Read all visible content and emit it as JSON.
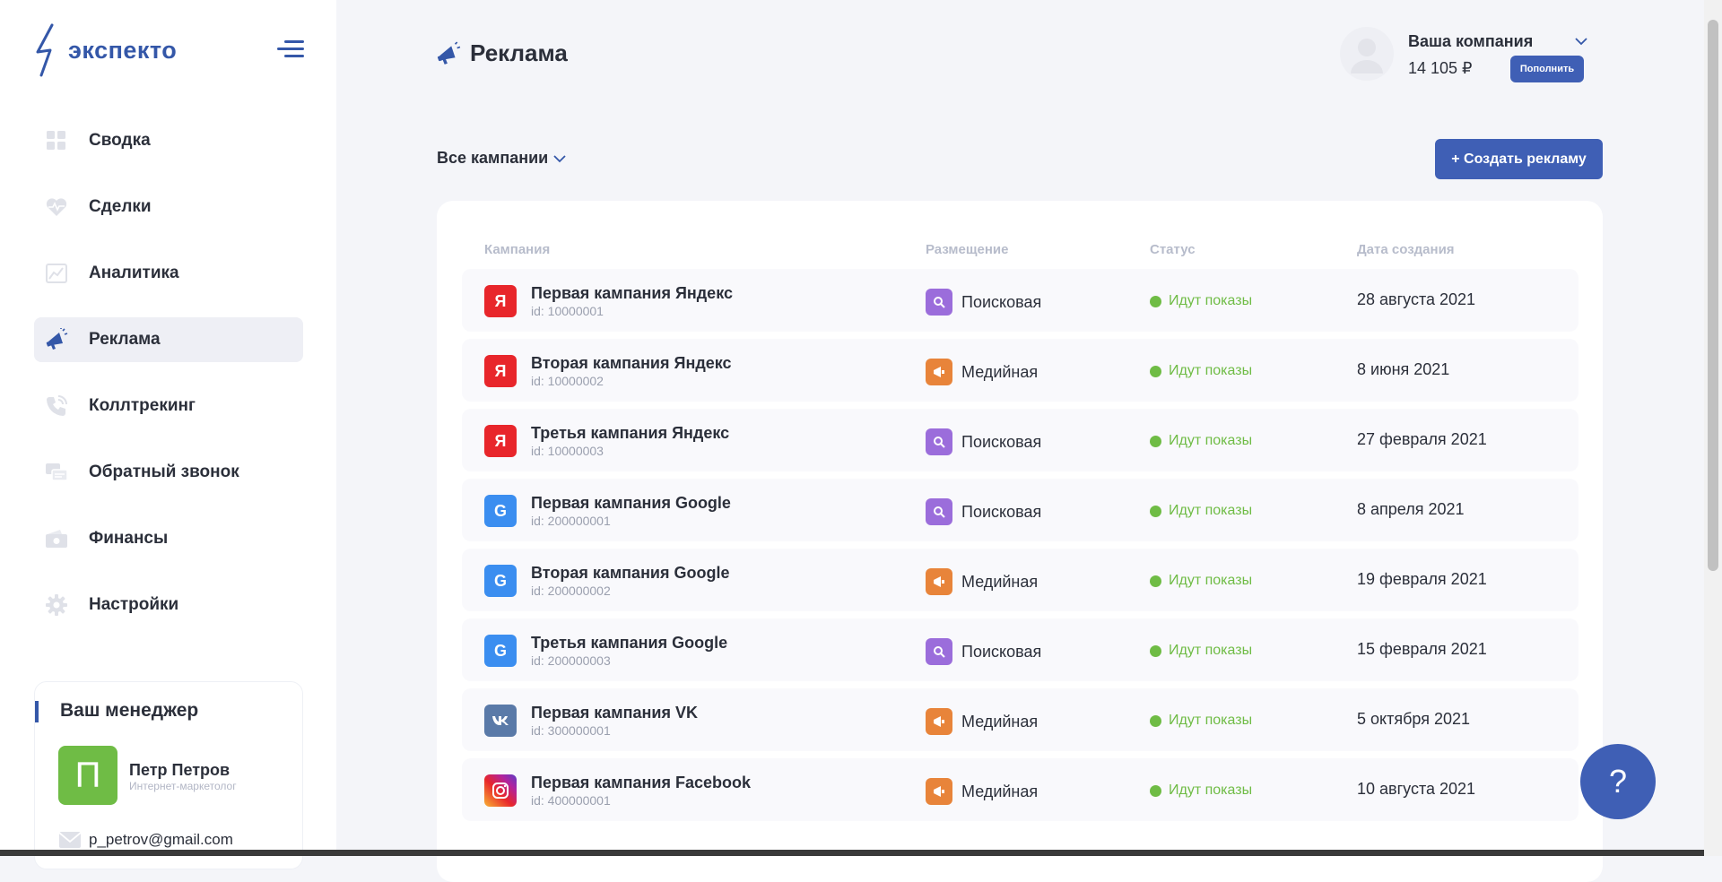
{
  "brand": {
    "name": "экспекто",
    "color": "#3457a8"
  },
  "nav": {
    "items": [
      {
        "label": "Сводка",
        "icon": "dashboard-icon"
      },
      {
        "label": "Сделки",
        "icon": "deals-icon"
      },
      {
        "label": "Аналитика",
        "icon": "analytics-icon"
      },
      {
        "label": "Реклама",
        "icon": "megaphone-icon",
        "active": true
      },
      {
        "label": "Коллтрекинг",
        "icon": "phone-icon"
      },
      {
        "label": "Обратный звонок",
        "icon": "callback-icon"
      },
      {
        "label": "Финансы",
        "icon": "wallet-icon"
      },
      {
        "label": "Настройки",
        "icon": "gear-icon"
      }
    ]
  },
  "manager": {
    "title": "Ваш менеджер",
    "initial": "П",
    "name": "Петр Петров",
    "role": "Интернет-маркетолог",
    "email": "p_petrov@gmail.com"
  },
  "header": {
    "title": "Реклама",
    "company": "Ваша компания",
    "balance": "14 105 ₽",
    "topup_label": "Пополнить"
  },
  "toolbar": {
    "filter_label": "Все кампании",
    "create_label": "+ Создать рекламу"
  },
  "table": {
    "columns": [
      "Кампания",
      "Размещение",
      "Статус",
      "Дата создания"
    ],
    "rows": [
      {
        "logo": "Я",
        "name": "Первая кампания Яндекс",
        "id": "id: 10000001",
        "placement": "Поисковая",
        "status": "Идут показы",
        "date": "28 августа 2021"
      },
      {
        "logo": "Я",
        "name": "Вторая кампания Яндекс",
        "id": "id: 10000002",
        "placement": "Медийная",
        "status": "Идут показы",
        "date": "8 июня 2021"
      },
      {
        "logo": "Я",
        "name": "Третья кампания Яндекс",
        "id": "id: 10000003",
        "placement": "Поисковая",
        "status": "Идут показы",
        "date": "27 февраля 2021"
      },
      {
        "logo": "G",
        "name": "Первая кампания Google",
        "id": "id: 200000001",
        "placement": "Поисковая",
        "status": "Идут показы",
        "date": "8 апреля 2021"
      },
      {
        "logo": "G",
        "name": "Вторая кампания Google",
        "id": "id: 200000002",
        "placement": "Медийная",
        "status": "Идут показы",
        "date": "19 февраля 2021"
      },
      {
        "logo": "G",
        "name": "Третья кампания Google",
        "id": "id: 200000003",
        "placement": "Поисковая",
        "status": "Идут показы",
        "date": "15 февраля 2021"
      },
      {
        "logo": "vk",
        "name": "Первая кампания VK",
        "id": "id: 300000001",
        "placement": "Медийная",
        "status": "Идут показы",
        "date": "5 октября 2021"
      },
      {
        "logo": "instagram",
        "name": "Первая кампания Facebook",
        "id": "id: 400000001",
        "placement": "Медийная",
        "status": "Идут показы",
        "date": "10 августа 2021"
      }
    ]
  },
  "help_label": "?",
  "colors": {
    "accent": "#3f5fb5",
    "yandex": "#e8262b",
    "google": "#3b8ef0",
    "vk": "#5a7aa8",
    "search": "#9b6ddb",
    "media": "#e8843a",
    "status_ok": "#6fbc45"
  }
}
